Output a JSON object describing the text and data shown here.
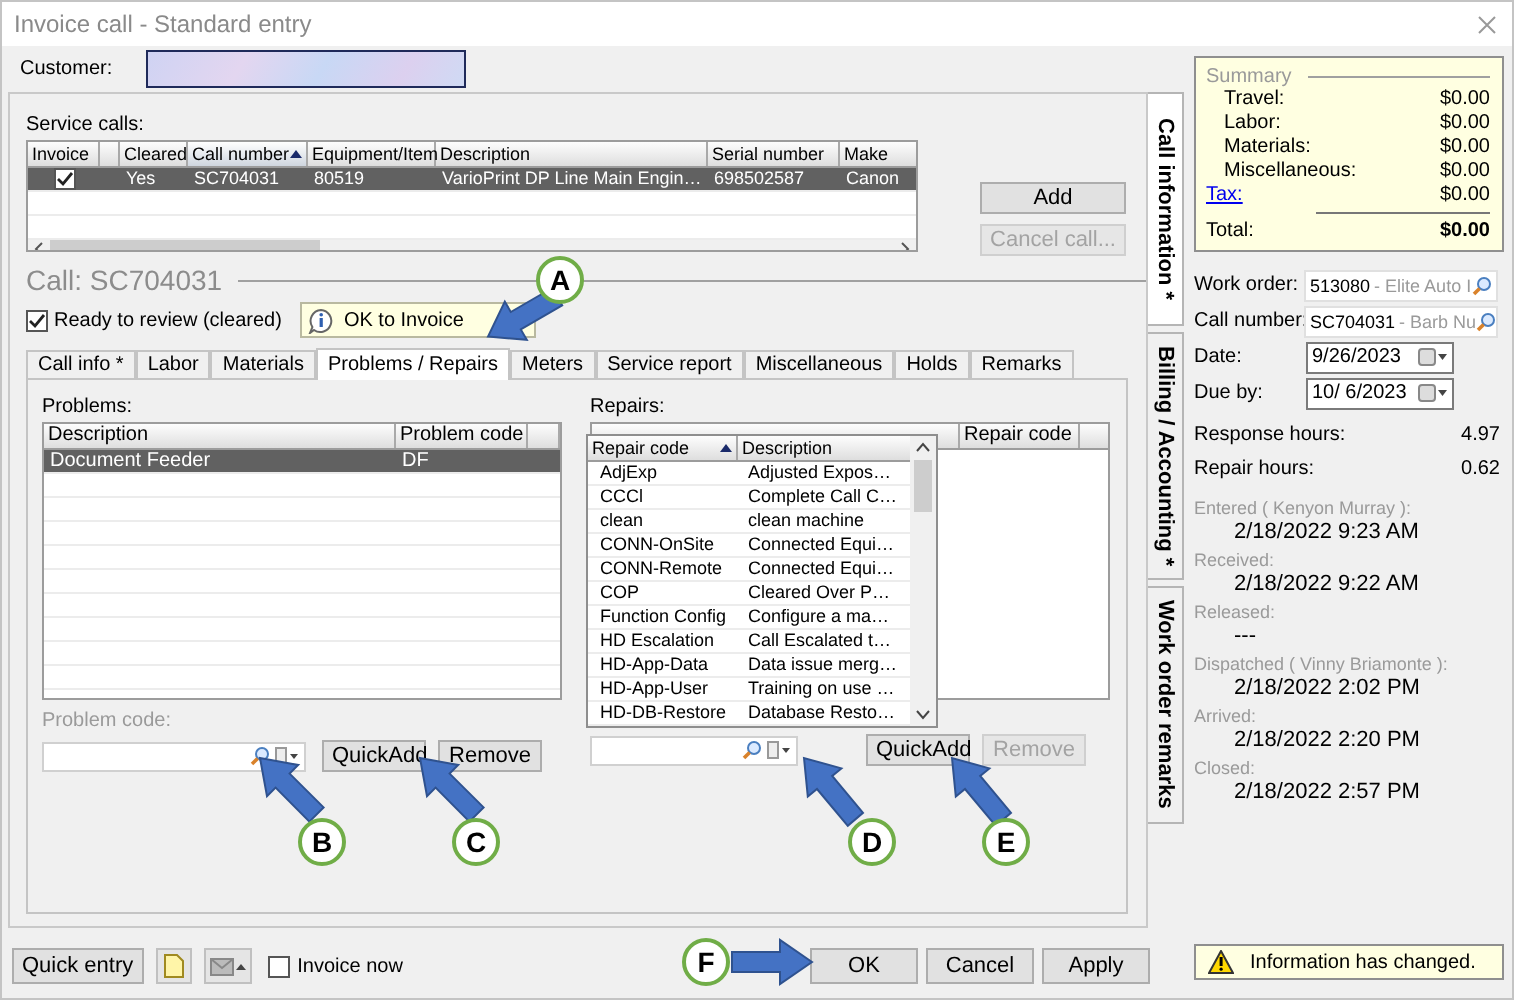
{
  "window": {
    "title": "Invoice call - Standard entry"
  },
  "customer": {
    "label": "Customer:"
  },
  "service_calls": {
    "label": "Service calls:",
    "invoice_column": {
      "label": "Invoice"
    },
    "columns": [
      {
        "label": "Cleared",
        "sorted": false
      },
      {
        "label": "Call number",
        "sorted": true
      },
      {
        "label": "Equipment/Item",
        "sorted": false
      },
      {
        "label": "Description",
        "sorted": false
      },
      {
        "label": "Serial number",
        "sorted": false
      },
      {
        "label": "Make",
        "sorted": false
      }
    ],
    "rows": [
      {
        "invoice": true,
        "cells": [
          "Yes",
          "SC704031",
          "80519",
          "VarioPrint DP Line Main Engin…",
          "698502587",
          "Canon"
        ],
        "selected": true
      }
    ],
    "buttons": [
      {
        "label": "Add",
        "disabled": false
      },
      {
        "label": "Cancel call...",
        "disabled": true
      }
    ]
  },
  "call": {
    "title": "Call: SC704031",
    "ready_label": "Ready to review (cleared)",
    "ready_checked": true,
    "tooltip": "OK to Invoice"
  },
  "tabs": [
    {
      "label": "Call info *",
      "selected": false
    },
    {
      "label": "Labor",
      "selected": false
    },
    {
      "label": "Materials",
      "selected": false
    },
    {
      "label": "Problems / Repairs",
      "selected": true
    },
    {
      "label": "Meters",
      "selected": false
    },
    {
      "label": "Service report",
      "selected": false
    },
    {
      "label": "Miscellaneous",
      "selected": false
    },
    {
      "label": "Holds",
      "selected": false
    },
    {
      "label": "Remarks",
      "selected": false
    }
  ],
  "problems": {
    "label": "Problems:",
    "columns": [
      "Description",
      "Problem code"
    ],
    "rows": [
      {
        "description": "Document Feeder",
        "code": "DF",
        "selected": true
      }
    ],
    "code_label": "Problem code:",
    "buttons": [
      {
        "label": "QuickAdd",
        "disabled": false
      },
      {
        "label": "Remove",
        "disabled": false
      }
    ]
  },
  "repairs": {
    "label": "Repairs:",
    "columns": [
      "Repair code"
    ],
    "popup": {
      "columns": [
        {
          "label": "Repair code",
          "sorted": true
        },
        {
          "label": "Description",
          "sorted": false
        }
      ],
      "rows": [
        {
          "code": "AdjExp",
          "description": "Adjusted Expos…"
        },
        {
          "code": "CCCl",
          "description": "Complete Call C…"
        },
        {
          "code": "clean",
          "description": "clean machine"
        },
        {
          "code": "CONN-OnSite",
          "description": "Connected Equi…"
        },
        {
          "code": "CONN-Remote",
          "description": "Connected Equi…"
        },
        {
          "code": "COP",
          "description": "Cleared Over P…"
        },
        {
          "code": "Function Config",
          "description": "Configure a ma…"
        },
        {
          "code": "HD Escalation",
          "description": "Call Escalated t…"
        },
        {
          "code": "HD-App-Data",
          "description": "Data issue merg…"
        },
        {
          "code": "HD-App-User",
          "description": "Training on use …"
        },
        {
          "code": "HD-DB-Restore",
          "description": "Database Resto…"
        }
      ]
    },
    "buttons": [
      {
        "label": "QuickAdd",
        "disabled": false
      },
      {
        "label": "Remove",
        "disabled": true
      }
    ]
  },
  "callouts": [
    {
      "letter": "A"
    },
    {
      "letter": "B"
    },
    {
      "letter": "C"
    },
    {
      "letter": "D"
    },
    {
      "letter": "E"
    },
    {
      "letter": "F"
    }
  ],
  "bottom": {
    "quick_entry": "Quick entry",
    "invoice_now": {
      "label": "Invoice now",
      "checked": false
    },
    "buttons": [
      "OK",
      "Cancel",
      "Apply"
    ]
  },
  "side_tabs": [
    {
      "label": "Call information *",
      "selected": true
    },
    {
      "label": "Billing / Accounting *",
      "selected": false
    },
    {
      "label": "Work order remarks",
      "selected": false
    }
  ],
  "summary": {
    "title": "Summary",
    "rows": [
      {
        "label": "Travel:",
        "value": "$0.00",
        "kind": "plain"
      },
      {
        "label": "Labor:",
        "value": "$0.00",
        "kind": "plain"
      },
      {
        "label": "Materials:",
        "value": "$0.00",
        "kind": "plain"
      },
      {
        "label": "Miscellaneous:",
        "value": "$0.00",
        "kind": "plain"
      },
      {
        "label": "Tax:",
        "value": "$0.00",
        "kind": "link"
      }
    ],
    "total": {
      "label": "Total:",
      "value": "$0.00"
    }
  },
  "fields": [
    {
      "label": "Work order:",
      "value": "513080",
      "detail": "- Elite Auto I",
      "kind": "lookup"
    },
    {
      "label": "Call number:",
      "value": "SC704031",
      "detail": "- Barb Nu",
      "kind": "lookup"
    },
    {
      "label": "Date:",
      "value": "9/26/2023",
      "kind": "date"
    },
    {
      "label": "Due by:",
      "value": "10/ 6/2023",
      "kind": "date"
    }
  ],
  "hours": [
    {
      "label": "Response hours:",
      "value": "4.97"
    },
    {
      "label": "Repair hours:",
      "value": "0.62"
    }
  ],
  "timeline": [
    {
      "label": "Entered ( Kenyon Murray ):",
      "value": "2/18/2022 9:23 AM"
    },
    {
      "label": "Received:",
      "value": "2/18/2022 9:22 AM"
    },
    {
      "label": "Released:",
      "value": "---"
    },
    {
      "label": "Dispatched ( Vinny Briamonte ):",
      "value": "2/18/2022 2:02 PM"
    },
    {
      "label": "Arrived:",
      "value": "2/18/2022 2:20 PM"
    },
    {
      "label": "Closed:",
      "value": "2/18/2022 2:57 PM"
    }
  ],
  "status": {
    "message": "Information has changed."
  }
}
